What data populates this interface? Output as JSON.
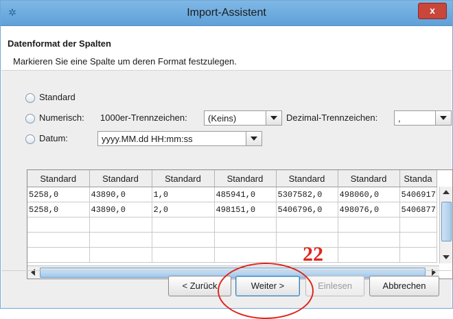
{
  "window": {
    "title": "Import-Assistent",
    "close_label": "x",
    "icon": "gear-app-icon"
  },
  "header": {
    "title": "Datenformat der Spalten",
    "subtitle": "Markieren Sie eine Spalte um deren Format festzulegen."
  },
  "format": {
    "standard_label": "Standard",
    "numeric_label": "Numerisch:",
    "thousands_label": "1000er-Trennzeichen:",
    "thousands_value": "(Keins)",
    "decimal_label": "Dezimal-Trennzeichen:",
    "decimal_value": ",",
    "date_label": "Datum:",
    "date_value": "yyyy.MM.dd HH:mm:ss"
  },
  "table": {
    "headers": [
      "Standard",
      "Standard",
      "Standard",
      "Standard",
      "Standard",
      "Standard",
      "Standa"
    ],
    "rows": [
      [
        "5258,0",
        "43890,0",
        "1,0",
        "485941,0",
        "5307582,0",
        "498060,0",
        "5406917"
      ],
      [
        "5258,0",
        "43890,0",
        "2,0",
        "498151,0",
        "5406796,0",
        "498076,0",
        "5406877"
      ]
    ]
  },
  "buttons": {
    "back": "< Zurück",
    "next": "Weiter >",
    "import": "Einlesen",
    "cancel": "Abbrechen"
  },
  "annotation": {
    "number": "22"
  },
  "colors": {
    "annotation_red": "#e0261b",
    "titlebar": "#6aaae0"
  }
}
